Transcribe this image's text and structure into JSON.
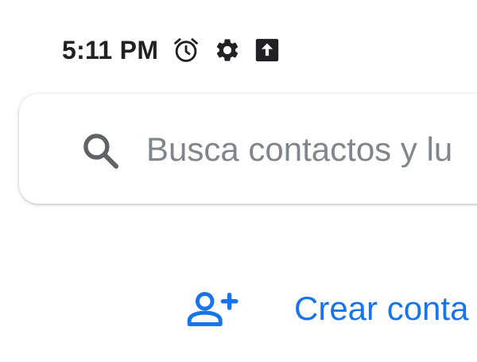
{
  "status_bar": {
    "time": "5:11 PM",
    "icons": [
      "alarm-icon",
      "settings-icon",
      "upload-icon"
    ]
  },
  "search": {
    "placeholder": "Busca contactos y lu",
    "value": ""
  },
  "create_contact": {
    "label": "Crear conta",
    "icon": "add-person-icon"
  },
  "colors": {
    "accent": "#1a73e8",
    "text_primary": "#202124",
    "placeholder": "#80868b",
    "icon_gray": "#5f6368"
  }
}
